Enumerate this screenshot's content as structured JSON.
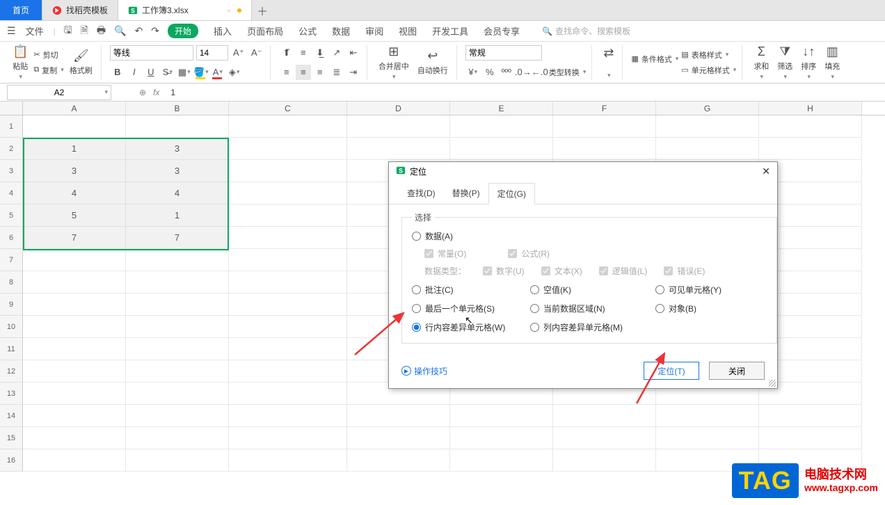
{
  "tabs": {
    "home": "首页",
    "t1": "找稻壳模板",
    "t2": "工作簿3.xlsx"
  },
  "menubar": {
    "file": "文件",
    "start": "开始",
    "items": [
      "插入",
      "页面布局",
      "公式",
      "数据",
      "审阅",
      "视图",
      "开发工具",
      "会员专享"
    ],
    "search_placeholder": "查找命令、搜索模板"
  },
  "ribbon": {
    "paste": "粘贴",
    "cut": "剪切",
    "copy": "复制",
    "format_painter": "格式刷",
    "font_name": "等线",
    "font_size": "14",
    "merge": "合并居中",
    "wrap": "自动换行",
    "number_format": "常规",
    "type_convert": "类型转换",
    "cond_format": "条件格式",
    "table_style": "表格样式",
    "cell_style": "单元格样式",
    "sum": "求和",
    "filter": "筛选",
    "sort": "排序",
    "fill": "填充"
  },
  "formula_bar": {
    "name_box": "A2",
    "fx": "fx",
    "value": "1"
  },
  "columns": [
    "A",
    "B",
    "C",
    "D",
    "E",
    "F",
    "G",
    "H"
  ],
  "rows": [
    "1",
    "2",
    "3",
    "4",
    "5",
    "6",
    "7",
    "8",
    "9",
    "10",
    "11",
    "12",
    "13",
    "14",
    "15",
    "16"
  ],
  "grid": {
    "r2": {
      "A": "1",
      "B": "3"
    },
    "r3": {
      "A": "3",
      "B": "3"
    },
    "r4": {
      "A": "4",
      "B": "4"
    },
    "r5": {
      "A": "5",
      "B": "1"
    },
    "r6": {
      "A": "7",
      "B": "7"
    }
  },
  "dialog": {
    "title": "定位",
    "tabs": {
      "find": "查找(D)",
      "replace": "替换(P)",
      "goto": "定位(G)"
    },
    "legend": "选择",
    "options": {
      "data": "数据(A)",
      "constant": "常量(O)",
      "formula": "公式(R)",
      "data_type": "数据类型：",
      "number": "数字(U)",
      "text": "文本(X)",
      "logical": "逻辑值(L)",
      "error": "错误(E)",
      "comment": "批注(C)",
      "blank": "空值(K)",
      "visible": "可见单元格(Y)",
      "last": "最后一个单元格(S)",
      "region": "当前数据区域(N)",
      "object": "对象(B)",
      "row_diff": "行内容差异单元格(W)",
      "col_diff": "列内容差异单元格(M)"
    },
    "tips": "操作技巧",
    "go_btn": "定位(T)",
    "close_btn": "关闭"
  },
  "watermark": {
    "tag": "TAG",
    "l1": "电脑技术网",
    "l2": "www.tagxp.com"
  }
}
